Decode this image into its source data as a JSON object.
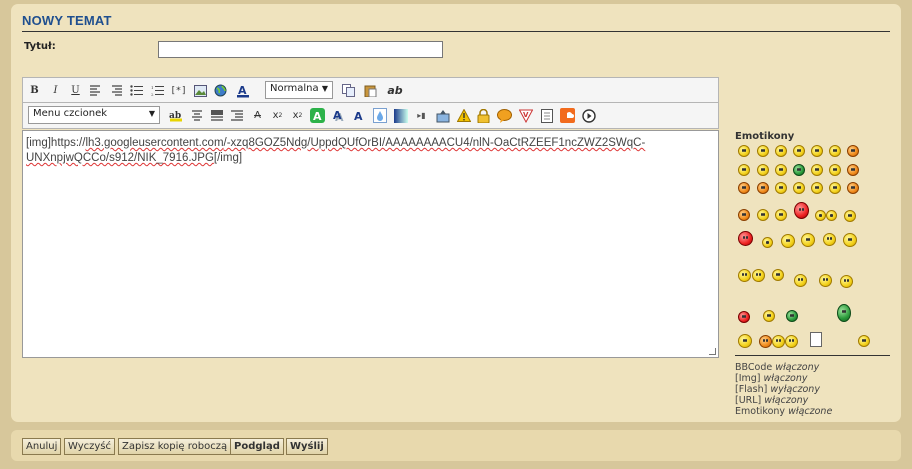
{
  "form": {
    "title": "NOWY TEMAT",
    "title_label": "Tytuł:",
    "title_value": ""
  },
  "toolbar": {
    "bold": "B",
    "italic": "I",
    "underline": "U",
    "size_select": "Normalna",
    "font_select": "Menu czcionek",
    "special": "ab"
  },
  "editor": {
    "line1_prefix": "[img]https://",
    "line1_host": "lh3.googleusercontent.com",
    "line1_path": "/-xzq8GOZ5Ndg/UppdQUfOrBI/AAAAAAAACU4/nlN-OaCtRZEEF1ncZWZ2SWqC-",
    "line2_path": "UNXnpjwQCCo/s912/NIK_7916.JPG",
    "line2_suffix": "[/img]"
  },
  "emoticons": {
    "heading": "Emotikony"
  },
  "status": {
    "bbcode": "BBCode",
    "bbcode_state": "włączony",
    "img": "[Img]",
    "img_state": "włączony",
    "flash": "[Flash]",
    "flash_state": "wyłączony",
    "url": "[URL]",
    "url_state": "włączony",
    "emoticons": "Emotikony",
    "emoticons_state": "włączone"
  },
  "buttons": {
    "cancel": "Anuluj",
    "clear": "Wyczyść",
    "save_draft": "Zapisz kopię roboczą",
    "preview": "Podgląd",
    "submit": "Wyślij"
  }
}
